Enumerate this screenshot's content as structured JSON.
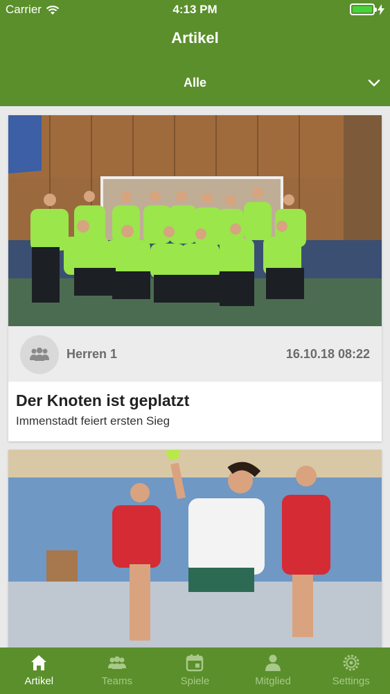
{
  "status_bar": {
    "carrier": "Carrier",
    "time": "4:13 PM"
  },
  "header": {
    "title": "Artikel",
    "filter_label": "Alle"
  },
  "articles": [
    {
      "team": "Herren 1",
      "date": "16.10.18 08:22",
      "title": "Der Knoten ist geplatzt",
      "subtitle": "Immenstadt feiert ersten Sieg"
    }
  ],
  "tabs": [
    {
      "label": "Artikel",
      "icon": "home-icon",
      "active": true
    },
    {
      "label": "Teams",
      "icon": "group-icon",
      "active": false
    },
    {
      "label": "Spiele",
      "icon": "calendar-icon",
      "active": false
    },
    {
      "label": "Mitglied",
      "icon": "person-icon",
      "active": false
    },
    {
      "label": "Settings",
      "icon": "gear-icon",
      "active": false
    }
  ],
  "colors": {
    "primary": "#5a8f2b",
    "tab_inactive": "#a9c98a",
    "battery": "#46d33a"
  }
}
